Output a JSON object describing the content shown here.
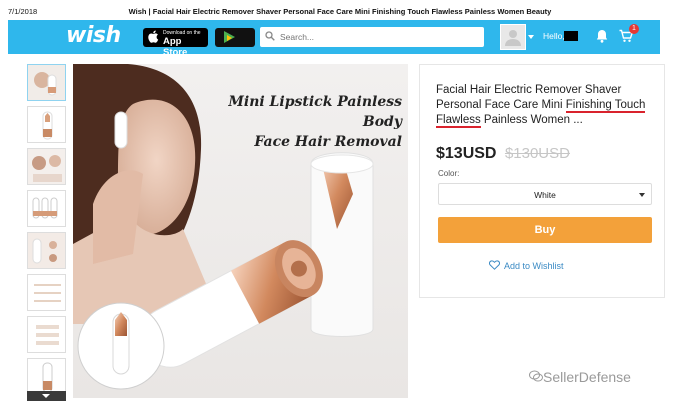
{
  "print_header": {
    "date": "7/1/2018",
    "title": "Wish | Facial Hair Electric Remover Shaver Personal Face Care Mini Finishing Touch Flawless Painless Women Beauty"
  },
  "topbar": {
    "logo": "wish",
    "app_store": {
      "small": "Download on the",
      "big": "App Store"
    },
    "google_play_icon": "google-play-icon",
    "search": {
      "placeholder": "Search...",
      "value": ""
    },
    "greeting": "Hello,",
    "cart_count": "1",
    "colors": {
      "bar": "#2fb7ec"
    }
  },
  "thumbnails": [
    {
      "label": "thumb-1"
    },
    {
      "label": "thumb-2"
    },
    {
      "label": "thumb-3"
    },
    {
      "label": "thumb-4"
    },
    {
      "label": "thumb-5"
    },
    {
      "label": "thumb-6"
    },
    {
      "label": "thumb-7"
    },
    {
      "label": "thumb-8"
    }
  ],
  "main_image": {
    "caption_line1": "Mini Lipstick Painless Body",
    "caption_line2": "Face Hair Removal"
  },
  "product": {
    "title_line1": "Facial Hair Electric Remover Shaver",
    "title_line2a": "Personal Face Care Mini ",
    "title_line2b": "Finishing Touch",
    "title_line3a": "Flawless",
    "title_line3b": " Painless Women ...",
    "price": "$13USD",
    "original_price": "$130USD",
    "color_label": "Color:",
    "color_value": "White",
    "buy_label": "Buy",
    "wishlist_label": "Add to Wishlist",
    "colors": {
      "buy": "#f3a13a",
      "underline": "#d9232d",
      "link": "#3a8ac4"
    }
  },
  "watermark": "SellerDefense"
}
